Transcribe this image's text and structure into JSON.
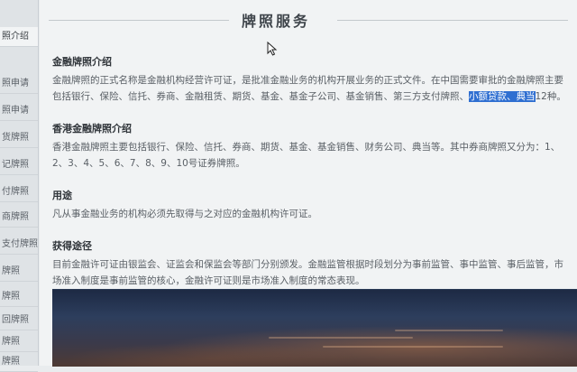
{
  "sidebar": {
    "items": [
      {
        "label": "照介绍"
      },
      {
        "label": "照申请"
      },
      {
        "label": "照申请"
      },
      {
        "label": "货牌照"
      },
      {
        "label": "记牌照"
      },
      {
        "label": "付牌照"
      },
      {
        "label": "商牌照"
      },
      {
        "label": "支付牌照"
      },
      {
        "label": "牌照"
      },
      {
        "label": "牌照"
      },
      {
        "label": "回牌照"
      },
      {
        "label": "牌照"
      },
      {
        "label": "牌照"
      }
    ]
  },
  "page": {
    "title": "牌照服务"
  },
  "sections": [
    {
      "heading": "金融牌照介绍",
      "body_before": "金融牌照的正式名称是金融机构经营许可证，是批准金融业务的机构开展业务的正式文件。在中国需要审批的金融牌照主要包括银行、保险、信托、券商、金融租赁、期货、基金、基金子公司、基金销售、第三方支付牌照、",
      "body_highlight": "小额贷款、典当",
      "body_after": "12种。"
    },
    {
      "heading": "香港金融牌照介绍",
      "body": "香港金融牌照主要包括银行、保险、信托、券商、期货、基金、基金销售、财务公司、典当等。其中券商牌照又分为：1、2、3、4、5、6、7、8、9、10号证券牌照。"
    },
    {
      "heading": "用途",
      "body": "凡从事金融业务的机构必须先取得与之对应的金融机构许可证。"
    },
    {
      "heading": "获得途径",
      "body": "目前金融许可证由银监会、证监会和保监会等部门分别颁发。金融监管根据时段划分为事前监管、事中监管、事后监管，市场准入制度是事前监管的核心，金融许可证则是市场准入制度的常态表现。"
    }
  ],
  "colors": {
    "highlight": "#2f6fd1",
    "background": "#f1f3f4"
  },
  "icons": {
    "cursor": "mouse-pointer-icon"
  }
}
